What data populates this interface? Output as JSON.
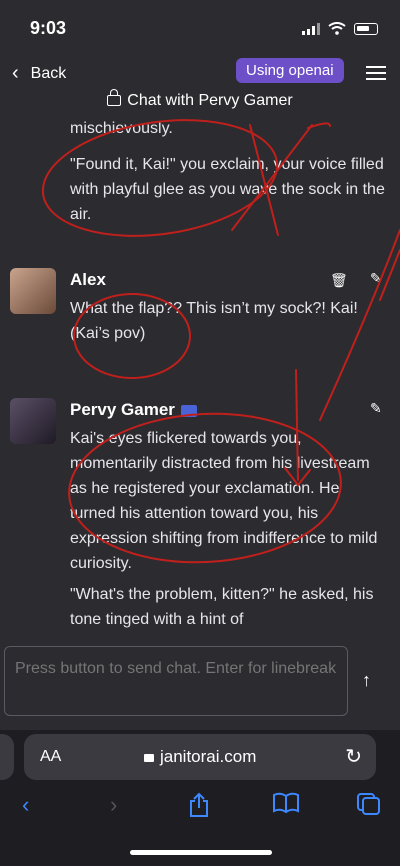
{
  "status": {
    "time": "9:03"
  },
  "header": {
    "back_label": "Back",
    "provider_badge": "Using openai",
    "chat_title": "Chat with Pervy Gamer"
  },
  "messages": {
    "prev_tail": [
      "mischievously.",
      "\"Found it, Kai!\" you exclaim, your voice filled with playful glee as you wave the sock in the air."
    ],
    "alex": {
      "name": "Alex",
      "text": "What the flap?? This isn’t my sock?! Kai! (Kai’s pov)"
    },
    "gamer": {
      "name": "Pervy Gamer",
      "p1": "Kai's eyes flickered towards you, momentarily distracted from his livestream as he registered your exclamation. He turned his attention toward you, his expression shifting from indifference to mild curiosity.",
      "p2": "\"What's the problem, kitten?\" he asked, his tone tinged with a hint of"
    }
  },
  "composer": {
    "placeholder": "Press button to send chat. Enter for linebreak"
  },
  "browser": {
    "aa_label": "AA",
    "url": "janitorai.com"
  },
  "icons": {
    "back": "chevron-left-icon",
    "menu": "hamburger-icon",
    "lock": "lock-icon",
    "delete": "trash-icon",
    "edit": "pencil-icon",
    "send": "arrow-up-icon",
    "reload": "reload-icon",
    "share": "share-icon",
    "bookmarks": "book-icon",
    "tabs": "tabs-icon"
  },
  "colors": {
    "badge": "#6d4fc8",
    "background": "#2b2b30",
    "link": "#3d87ff",
    "ink": "#c0201c"
  }
}
